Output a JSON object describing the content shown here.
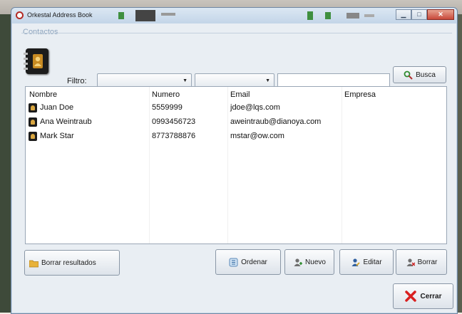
{
  "window": {
    "title": "Orkestal Address Book",
    "minimize": "▁",
    "maximize": "□",
    "close": "✕"
  },
  "group": {
    "title": "Contactos"
  },
  "filter": {
    "label": "Filtro:",
    "combo1_value": "",
    "combo2_value": "",
    "text_value": "",
    "search_button": "Busca"
  },
  "list": {
    "columns": [
      "Nombre",
      "Numero",
      "Email",
      "Empresa"
    ],
    "rows": [
      {
        "nombre": "Juan Doe",
        "numero": "5559999",
        "email": "jdoe@lqs.com",
        "empresa": ""
      },
      {
        "nombre": "Ana Weintraub",
        "numero": "0993456723",
        "email": "aweintraub@dianoya.com",
        "empresa": ""
      },
      {
        "nombre": "Mark Star",
        "numero": "8773788876",
        "email": "mstar@ow.com",
        "empresa": ""
      }
    ]
  },
  "buttons": {
    "clear": "Borrar resultados",
    "sort": "Ordenar",
    "new": "Nuevo",
    "edit": "Editar",
    "delete": "Borrar",
    "close": "Cerrar"
  },
  "icons": {
    "app": "app-icon",
    "logo": "address-book-icon",
    "search": "search-icon",
    "clear": "folder-icon",
    "sort": "sort-icon",
    "new": "add-user-icon",
    "edit": "edit-user-icon",
    "delete": "delete-user-icon",
    "close": "close-icon"
  },
  "colors": {
    "close_red": "#d92020",
    "accent_green": "#2e8b2e",
    "contact_icon": "#1c1c1c"
  }
}
